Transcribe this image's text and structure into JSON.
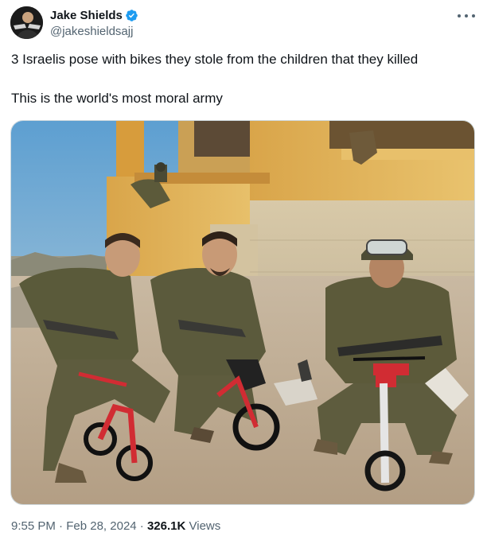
{
  "author": {
    "display_name": "Jake Shields",
    "handle": "@jakeshieldsajj",
    "verified_color": "#1d9bf0"
  },
  "tweet": {
    "text_line1": "3 Israelis pose with bikes they stole from the children that they killed",
    "text_line2": "This is the world's most moral army"
  },
  "meta": {
    "time": "9:55 PM",
    "separator": "·",
    "date": "Feb 28, 2024",
    "views_count": "326.1K",
    "views_label": "Views"
  },
  "icons": {
    "more": "more-horizontal-icon",
    "verified": "verified-badge-icon"
  }
}
